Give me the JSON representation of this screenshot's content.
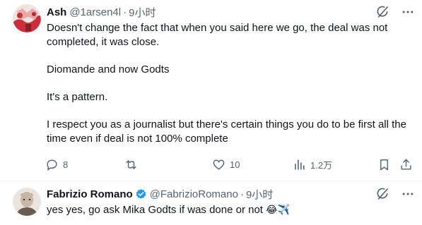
{
  "posts": [
    {
      "author_name": "Ash",
      "handle": "@1arsen4l",
      "separator": "·",
      "time": "9小时",
      "text": {
        "p1": "Doesn't change the fact that when you said here we go, the deal was not completed, it was close.",
        "p2": "Diomande and now Godts",
        "p3": "It's a pattern.",
        "p4": "I respect you as a journalist but there's certain things you do to be first all the time even if deal is not 100% complete"
      },
      "stats": {
        "replies": "8",
        "retweets": "",
        "likes": "10",
        "views": "1.2万"
      },
      "avatar_colors": [
        "#c9303a",
        "#e8a7a9",
        "#f3e2e2"
      ]
    },
    {
      "author_name": "Fabrizio Romano",
      "verified": true,
      "handle": "@FabrizioRomano",
      "separator": "·",
      "time": "9小时",
      "text": {
        "p1": "yes yes, go ask Mika Godts if was done or not",
        "emoji": "😂✈️"
      },
      "avatar_colors": [
        "#6b5b50",
        "#c8b6a6",
        "#e9e4de"
      ]
    }
  ],
  "icons": {
    "grok": "grok-icon",
    "more": "more-horizontal-icon",
    "reply": "reply-icon",
    "retweet": "retweet-icon",
    "like": "heart-icon",
    "views": "views-chart-icon",
    "bookmark": "bookmark-icon",
    "share": "share-icon",
    "verified": "verified-badge-icon"
  },
  "colors": {
    "text_primary": "#0f1419",
    "text_secondary": "#536471",
    "verified_blue": "#1d9bf0",
    "divider": "#eff3f4"
  }
}
